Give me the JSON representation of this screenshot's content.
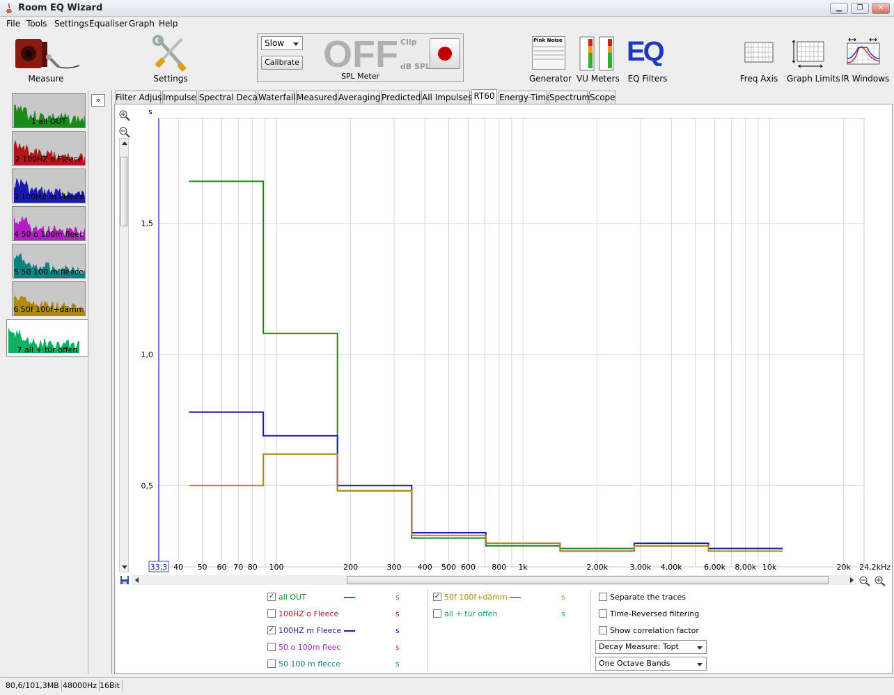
{
  "window": {
    "title": "Room EQ Wizard"
  },
  "menu": [
    "File",
    "Tools",
    "Settings",
    "Equaliser",
    "Graph",
    "Help"
  ],
  "toolbar": {
    "measure": "Measure",
    "settings": "Settings",
    "spl": {
      "mode": "Slow",
      "calibrate": "Calibrate",
      "reading": "OFF",
      "clip": "Clip",
      "unit": "dB SPL",
      "caption": "SPL Meter"
    },
    "generator": "Generator",
    "generator_mini": "Pink Noise",
    "vu_meters": "VU Meters",
    "eq_logo": "EQ",
    "eq_filters": "EQ Filters",
    "freq_axis": "Freq Axis",
    "graph_limits": "Graph Limits",
    "ir_windows": "IR Windows"
  },
  "measurements": [
    {
      "label": "1 all OUT",
      "color": "#1a8a1a"
    },
    {
      "label": "2 100HZ o Fleece",
      "color": "#b01818"
    },
    {
      "label": "3 100HZ m Fleece",
      "color": "#1a1ab0"
    },
    {
      "label": "4 50 o 100m fleec",
      "color": "#b020c0"
    },
    {
      "label": "5 50 100 m fleece",
      "color": "#108080"
    },
    {
      "label": "6 50f 100f+dämm",
      "color": "#b08a10"
    },
    {
      "label": "7 all + tür offen",
      "color": "#10b060"
    }
  ],
  "tabs": [
    "Filter Adjust",
    "Impulse",
    "Spectral Decay",
    "Waterfall",
    "Measured",
    "Averaging",
    "Predicted",
    "All Impulses",
    "RT60",
    "Energy-Time",
    "Spectrum",
    "Scope"
  ],
  "active_tab": "RT60",
  "chart_data": {
    "type": "line",
    "ylabel": "s",
    "xlabel": "",
    "xscale": "log",
    "xlim": [
      33.3,
      24200
    ],
    "ylim": [
      0.19,
      1.9
    ],
    "x_start_label": "33,3",
    "x_end_label": "24,2kHz",
    "xticks": [
      {
        "value": 40,
        "label": "40"
      },
      {
        "value": 50,
        "label": "50"
      },
      {
        "value": 60,
        "label": "60"
      },
      {
        "value": 70,
        "label": "70"
      },
      {
        "value": 80,
        "label": "80"
      },
      {
        "value": 100,
        "label": "100"
      },
      {
        "value": 200,
        "label": "200"
      },
      {
        "value": 300,
        "label": "300"
      },
      {
        "value": 400,
        "label": "400"
      },
      {
        "value": 500,
        "label": "500"
      },
      {
        "value": 600,
        "label": "600"
      },
      {
        "value": 800,
        "label": "800"
      },
      {
        "value": 1000,
        "label": "1k"
      },
      {
        "value": 2000,
        "label": "2,00k"
      },
      {
        "value": 3000,
        "label": "3,00k"
      },
      {
        "value": 4000,
        "label": "4,00k"
      },
      {
        "value": 6000,
        "label": "6,00k"
      },
      {
        "value": 8000,
        "label": "8,00k"
      },
      {
        "value": 10000,
        "label": "10k"
      },
      {
        "value": 20000,
        "label": "20k"
      }
    ],
    "yticks": [
      {
        "value": 0.5,
        "label": "0,5"
      },
      {
        "value": 1.0,
        "label": "1,0"
      },
      {
        "value": 1.5,
        "label": "1,5"
      }
    ],
    "grid": true,
    "band_edges": [
      44.2,
      88.4,
      176.8,
      353.6,
      707.1,
      1414.2,
      2828.4,
      5656.9,
      11313.7
    ],
    "series": [
      {
        "name": "all OUT",
        "color": "#1a8a1a",
        "values": [
          1.66,
          1.08,
          0.48,
          0.3,
          0.27,
          0.26,
          0.27,
          0.26
        ]
      },
      {
        "name": "100HZ m Fleece",
        "color": "#1a1ab0",
        "values": [
          0.78,
          0.69,
          0.5,
          0.32,
          0.28,
          0.25,
          0.28,
          0.26
        ]
      },
      {
        "name": "50f 100f+dämm",
        "color": "#b08a10",
        "values": [
          0.5,
          0.62,
          0.48,
          0.31,
          0.28,
          0.25,
          0.27,
          0.25
        ]
      }
    ],
    "cursor_x": 33.3
  },
  "legend": {
    "items": [
      {
        "name": "all OUT",
        "checked": true,
        "color": "#1a8a1a",
        "line": true,
        "unit": "s"
      },
      {
        "name": "100HZ o Fleece",
        "checked": false,
        "color": "#b01818",
        "line": false,
        "unit": "s"
      },
      {
        "name": "100HZ m Fleece",
        "checked": true,
        "color": "#1a1ab0",
        "line": true,
        "unit": "s"
      },
      {
        "name": "50 o 100m fleec",
        "checked": false,
        "color": "#b020c0",
        "line": false,
        "unit": "s"
      },
      {
        "name": "50 100 m flecce",
        "checked": false,
        "color": "#108080",
        "line": false,
        "unit": "s"
      },
      {
        "name": "50f 100f+dämm",
        "checked": true,
        "color": "#b08a10",
        "line": true,
        "unit": "s"
      },
      {
        "name": "all + tür offen",
        "checked": false,
        "color": "#10a070",
        "line": false,
        "unit": "s"
      }
    ],
    "options": [
      "Separate the traces",
      "Time-Reversed filtering",
      "Show correlation factor"
    ],
    "decay_measure": "Decay Measure: Topt",
    "bands": "One Octave Bands"
  },
  "status": {
    "memory": "80,6/101,3MB",
    "rate": "48000Hz",
    "bits": "16Bit"
  }
}
